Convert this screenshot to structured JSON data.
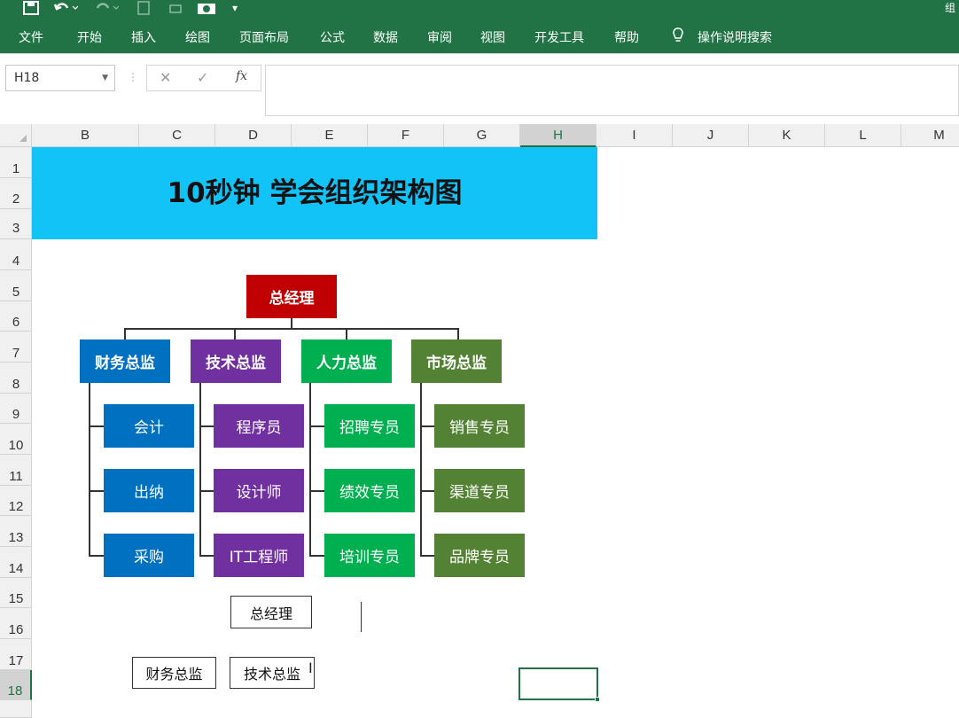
{
  "quick_access": {
    "save_icon": "save-icon",
    "undo_icon": "undo-icon",
    "redo_icon": "redo-icon",
    "camera_icon": "camera-icon",
    "customize_icon": "customize-icon"
  },
  "ribbon": {
    "tabs": [
      "文件",
      "开始",
      "插入",
      "绘图",
      "页面布局",
      "公式",
      "数据",
      "审阅",
      "视图",
      "开发工具",
      "帮助"
    ],
    "tell_me_icon": "lightbulb-icon",
    "tell_me": "操作说明搜索",
    "title_fragment": "组"
  },
  "formula_bar": {
    "name_box": "H18",
    "cancel_symbol": "✕",
    "enter_symbol": "✓",
    "fx_symbol": "fx",
    "formula": ""
  },
  "grid": {
    "columns": [
      "B",
      "C",
      "D",
      "E",
      "F",
      "G",
      "H",
      "I",
      "J",
      "K",
      "L",
      "M"
    ],
    "selected_column": "H",
    "rows": [
      "1",
      "2",
      "3",
      "4",
      "5",
      "6",
      "7",
      "8",
      "9",
      "10",
      "11",
      "12",
      "13",
      "14",
      "15",
      "16",
      "17",
      "18"
    ],
    "selected_row": "18"
  },
  "sheet": {
    "banner_title": "10秒钟 学会组织架构图",
    "colors": {
      "banner": "#12C3F8",
      "root": "#C00000",
      "blue": "#0070C0",
      "purple": "#7030A0",
      "green_dark": "#00B050",
      "green_light": "#00B050",
      "olive": "#548235",
      "excel_green": "#217346"
    },
    "org": {
      "root": "总经理",
      "departments": [
        {
          "name": "财务总监",
          "members": [
            "会计",
            "出纳",
            "采购"
          ]
        },
        {
          "name": "技术总监",
          "members": [
            "程序员",
            "设计师",
            "IT工程师"
          ]
        },
        {
          "name": "人力总监",
          "members": [
            "招聘专员",
            "绩效专员",
            "培训专员"
          ]
        },
        {
          "name": "市场总监",
          "members": [
            "销售专员",
            "渠道专员",
            "品牌专员"
          ]
        }
      ]
    },
    "draft": {
      "root": "总经理",
      "children": [
        "财务总监",
        "技术总监"
      ]
    }
  }
}
